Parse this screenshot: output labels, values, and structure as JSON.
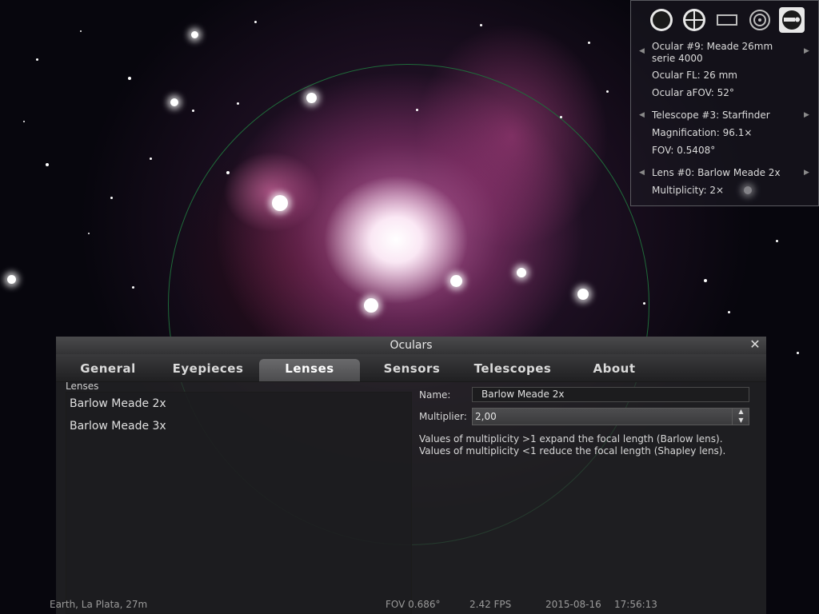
{
  "ocular_panel": {
    "toolbar": {
      "icons": [
        "ocular-view-icon",
        "crosshair-icon",
        "sensor-frame-icon",
        "telrad-icon",
        "ocular-settings-icon"
      ]
    },
    "ocular_line1": "Ocular #9: Meade 26mm",
    "ocular_line2": "serie 4000",
    "ocular_fl": "Ocular FL: 26 mm",
    "ocular_afov": "Ocular aFOV: 52°",
    "telescope": "Telescope #3: Starfinder",
    "magnification": "Magnification: 96.1×",
    "fov": "FOV: 0.5408°",
    "lens": "Lens #0: Barlow Meade 2x",
    "multiplicity": "Multiplicity: 2×"
  },
  "dialog": {
    "title": "Oculars",
    "close_symbol": "✕",
    "tabs": [
      {
        "label": "General"
      },
      {
        "label": "Eyepieces"
      },
      {
        "label": "Lenses"
      },
      {
        "label": "Sensors"
      },
      {
        "label": "Telescopes"
      },
      {
        "label": "About"
      }
    ],
    "active_tab": "Lenses",
    "list_label": "Lenses",
    "lenses": [
      {
        "label": "Barlow Meade 2x"
      },
      {
        "label": "Barlow Meade 3x"
      }
    ],
    "name_label": "Name:",
    "name_value": "Barlow Meade 2x",
    "multiplier_label": "Multiplier:",
    "multiplier_value": "2,00",
    "help_line1": "Values of multiplicity >1 expand the focal length (Barlow lens).",
    "help_line2": "Values of multiplicity <1 reduce the focal length (Shapley lens)."
  },
  "status_bar": {
    "location": "Earth, La Plata, 27m",
    "fov": "FOV 0.686°",
    "fps": "2.42 FPS",
    "date": "2015-08-16",
    "time": "17:56:13"
  },
  "colors": {
    "fov_circle": "#1f6b3a",
    "active_toolbar_button": "#e8e8e8",
    "dialog_background": "#2c2c2e"
  }
}
